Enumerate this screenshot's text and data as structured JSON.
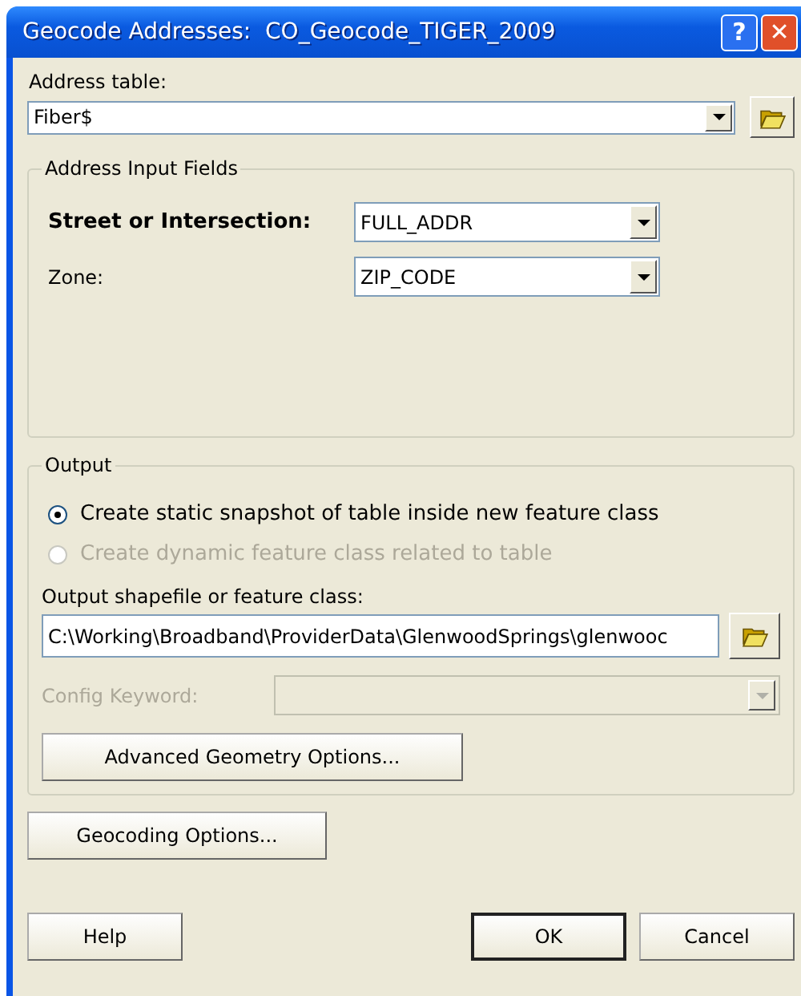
{
  "window": {
    "title": "Geocode Addresses:  CO_Geocode_TIGER_2009",
    "title_buttons": [
      "?",
      "✕"
    ]
  },
  "address_table": {
    "label": "Address table:",
    "value": "Fiber$"
  },
  "address_input_fields": {
    "title": "Address Input Fields",
    "rows": [
      {
        "label": "Street or Intersection:",
        "value": "FULL_ADDR",
        "kind": "required"
      },
      {
        "label": "Zone:",
        "value": "ZIP_CODE",
        "kind": "optional"
      }
    ]
  },
  "output": {
    "title": "Output",
    "options": [
      {
        "label": "Create static snapshot of table inside new feature class",
        "selected": true,
        "disabled": false
      },
      {
        "label": "Create dynamic feature class related to table",
        "selected": false,
        "disabled": true
      }
    ],
    "output_path": {
      "label": "Output shapefile or feature class:",
      "value": "C:\\Working\\Broadband\\ProviderData\\GlenwoodSprings\\glenwooc"
    },
    "config_keyword": {
      "label": "Config Keyword:",
      "disabled": true
    },
    "advanced_button": "Advanced Geometry Options..."
  },
  "geocoding_button": "Geocoding Options...",
  "buttons": [
    {
      "label": "Help",
      "default": false
    },
    {
      "label": "OK",
      "default": true
    },
    {
      "label": "Cancel",
      "default": false
    }
  ]
}
